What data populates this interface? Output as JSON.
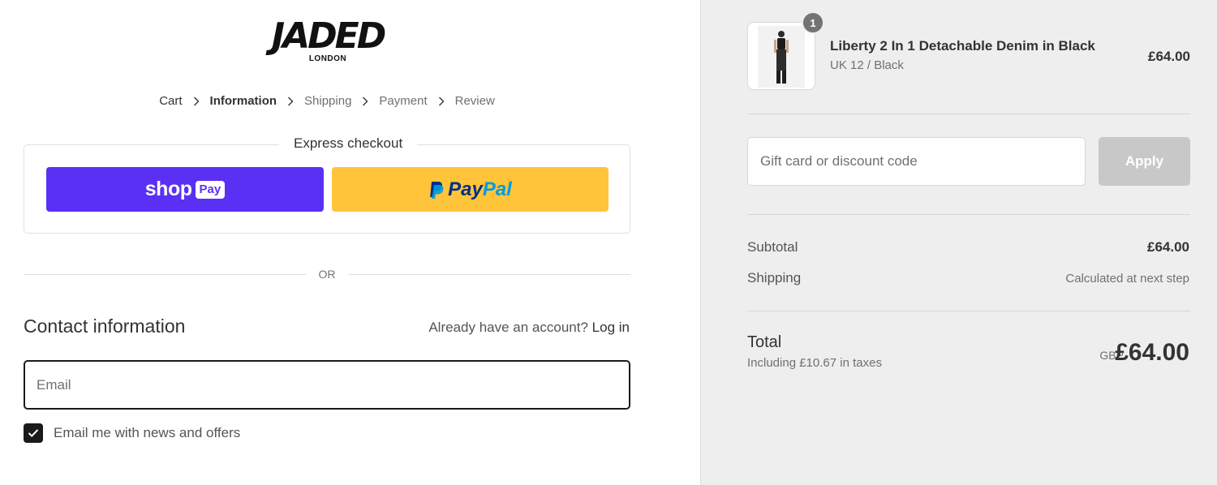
{
  "brand": {
    "logo_word": "JADED",
    "logo_sub": "LONDON"
  },
  "breadcrumb": {
    "items": [
      "Cart",
      "Information",
      "Shipping",
      "Payment",
      "Review"
    ],
    "active_index": 1
  },
  "express": {
    "title": "Express checkout",
    "shoppay_word": "shop",
    "shoppay_pill": "Pay",
    "paypal_word1": "Pay",
    "paypal_word2": "Pal",
    "shoppay_color": "#5a31f4",
    "paypal_color": "#ffc439"
  },
  "divider": {
    "or_text": "OR"
  },
  "contact": {
    "title": "Contact information",
    "account_prompt": "Already have an account?",
    "login_label": "Log in",
    "email_placeholder": "Email",
    "email_value": "",
    "news_label": "Email me with news and offers",
    "news_checked": true
  },
  "order": {
    "product": {
      "name": "Liberty 2 In 1 Detachable Denim in Black",
      "variant": "UK 12 / Black",
      "price": "£64.00",
      "quantity": "1"
    },
    "discount_placeholder": "Gift card or discount code",
    "apply_label": "Apply",
    "subtotal_label": "Subtotal",
    "subtotal_value": "£64.00",
    "shipping_label": "Shipping",
    "shipping_value": "Calculated at next step",
    "total_label": "Total",
    "total_sub": "Including £10.67 in taxes",
    "total_currency": "GBP",
    "total_value": "£64.00"
  }
}
